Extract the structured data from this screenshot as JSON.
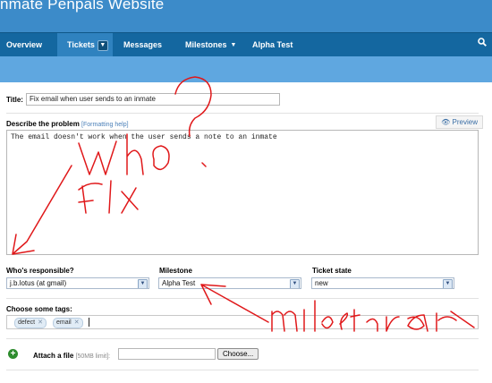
{
  "header": {
    "site_title": "nmate Penpals Website"
  },
  "nav": {
    "items": [
      {
        "label": "Overview"
      },
      {
        "label": "Tickets"
      },
      {
        "label": "Messages"
      },
      {
        "label": "Milestones"
      },
      {
        "label": "Alpha Test"
      }
    ],
    "active": "Tickets",
    "search_icon": "magnifier"
  },
  "form": {
    "title_label": "Title:",
    "title_value": "Fix email when user sends to an inmate",
    "describe_label": "Describe the problem",
    "formatting_help": "[Formatting help]",
    "preview_label": "Preview",
    "description": "The email doesn't work when the user sends a note to an inmate",
    "responsible_label": "Who's responsible?",
    "responsible_value": "j.b.lotus (at gmail)",
    "milestone_label": "Milestone",
    "milestone_value": "Alpha Test",
    "state_label": "Ticket state",
    "state_value": "new",
    "tags_label": "Choose some tags:",
    "tags": [
      "defect",
      "email"
    ],
    "attach_label": "Attach a file",
    "attach_limit": "[50MB limit]:",
    "choose_label": "Choose..."
  },
  "colors": {
    "header_blue": "#3c8bc9",
    "nav_blue": "#1467a0",
    "band_blue": "#5fa7e0",
    "annotation_red": "#e0181a"
  }
}
